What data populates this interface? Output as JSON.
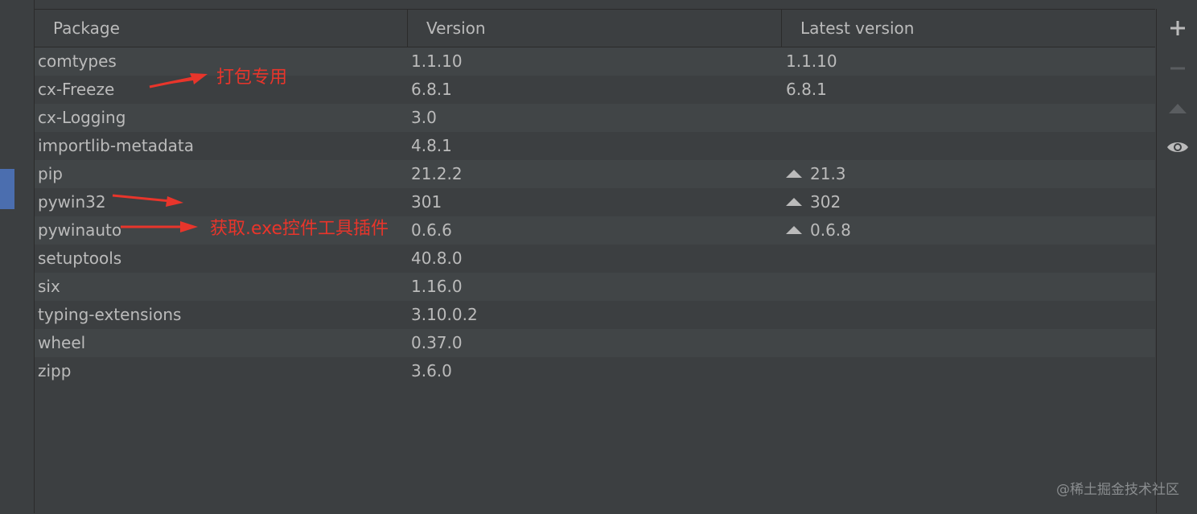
{
  "table": {
    "headers": [
      "Package",
      "Version",
      "Latest version"
    ],
    "rows": [
      {
        "package": "comtypes",
        "version": "1.1.10",
        "latest": "1.1.10",
        "upgrade": false
      },
      {
        "package": "cx-Freeze",
        "version": "6.8.1",
        "latest": "6.8.1",
        "upgrade": false
      },
      {
        "package": "cx-Logging",
        "version": "3.0",
        "latest": "",
        "upgrade": false
      },
      {
        "package": "importlib-metadata",
        "version": "4.8.1",
        "latest": "",
        "upgrade": false
      },
      {
        "package": "pip",
        "version": "21.2.2",
        "latest": "21.3",
        "upgrade": true
      },
      {
        "package": "pywin32",
        "version": "301",
        "latest": "302",
        "upgrade": true
      },
      {
        "package": "pywinauto",
        "version": "0.6.6",
        "latest": "0.6.8",
        "upgrade": true
      },
      {
        "package": "setuptools",
        "version": "40.8.0",
        "latest": "",
        "upgrade": false
      },
      {
        "package": "six",
        "version": "1.16.0",
        "latest": "",
        "upgrade": false
      },
      {
        "package": "typing-extensions",
        "version": "3.10.0.2",
        "latest": "",
        "upgrade": false
      },
      {
        "package": "wheel",
        "version": "0.37.0",
        "latest": "",
        "upgrade": false
      },
      {
        "package": "zipp",
        "version": "3.6.0",
        "latest": "",
        "upgrade": false
      }
    ]
  },
  "toolbar": {
    "add_icon": "plus-icon",
    "remove_icon": "minus-icon",
    "upgrade_icon": "triangle-up-icon",
    "show_early_icon": "eye-icon"
  },
  "annotations": {
    "packaging_note": "打包专用",
    "control_tool_note": "获取.exe控件工具插件"
  },
  "watermark": "@稀土掘金技术社区",
  "colors": {
    "background": "#3c3f41",
    "row_alt": "#414547",
    "text": "#bbbbbb",
    "annotation": "#e8352b",
    "accent": "#4b6eaf"
  }
}
